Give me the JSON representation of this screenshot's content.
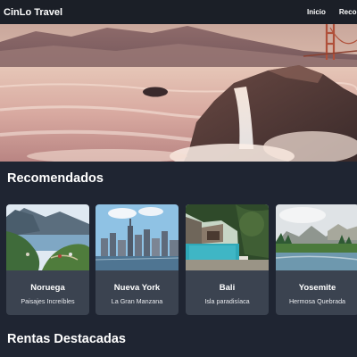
{
  "nav": {
    "brand": "CinLo Travel",
    "links": [
      "Inicio",
      "Recomendados"
    ]
  },
  "hero": {
    "image": "golden-gate-coast-waterfall-sunset"
  },
  "recommended": {
    "title": "Recomendados",
    "cards": [
      {
        "name": "Noruega",
        "subtitle": "Paisajes Increíbles",
        "image": "fjord-village"
      },
      {
        "name": "Nueva York",
        "subtitle": "La Gran Manzana",
        "image": "manhattan-skyline"
      },
      {
        "name": "Bali",
        "subtitle": "Isla paradisíaca",
        "image": "villa-pool-jungle"
      },
      {
        "name": "Yosemite",
        "subtitle": "Hermosa Quebrada",
        "image": "mountain-valley-river"
      }
    ]
  },
  "rentals": {
    "title": "Rentas Destacadas"
  },
  "colors": {
    "page_bg": "#1f2532",
    "nav_bg": "#1b1f27",
    "card_bg": "#3b4350"
  }
}
